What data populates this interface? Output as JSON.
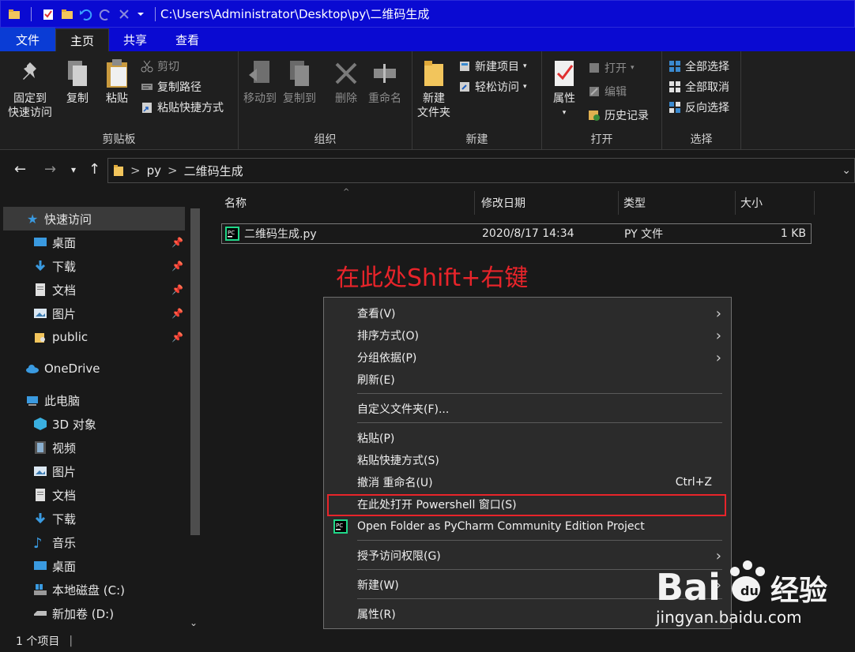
{
  "titlebar": {
    "path": "C:\\Users\\Administrator\\Desktop\\py\\二维码生成",
    "quick_access_icons": [
      "folder-icon",
      "properties-check-icon",
      "new-folder-icon",
      "undo-icon",
      "redo-icon",
      "delete-x-icon",
      "dropdown-arrow-icon"
    ]
  },
  "ribbon_tabs": {
    "file": "文件",
    "home": "主页",
    "share": "共享",
    "view": "查看"
  },
  "ribbon": {
    "clipboard": {
      "label": "剪贴板",
      "pin": "固定到\n快速访问",
      "pin_line1": "固定到",
      "pin_line2": "快速访问",
      "copy": "复制",
      "paste": "粘贴",
      "cut": "剪切",
      "copy_path": "复制路径",
      "paste_shortcut": "粘贴快捷方式"
    },
    "organize": {
      "label": "组织",
      "move_to": "移动到",
      "copy_to": "复制到",
      "delete": "删除",
      "rename": "重命名"
    },
    "new": {
      "label": "新建",
      "new_folder_line1": "新建",
      "new_folder_line2": "文件夹",
      "new_item": "新建项目",
      "easy_access": "轻松访问"
    },
    "open": {
      "label": "打开",
      "properties": "属性",
      "open": "打开",
      "edit": "编辑",
      "history": "历史记录"
    },
    "select": {
      "label": "选择",
      "select_all": "全部选择",
      "select_none": "全部取消",
      "invert": "反向选择"
    }
  },
  "address": {
    "crumbs": [
      "py",
      "二维码生成"
    ],
    "separator": ">"
  },
  "navpane": {
    "quick_access": "快速访问",
    "items": [
      {
        "label": "桌面",
        "pinned": true
      },
      {
        "label": "下载",
        "pinned": true
      },
      {
        "label": "文档",
        "pinned": true
      },
      {
        "label": "图片",
        "pinned": true
      },
      {
        "label": "public",
        "pinned": true
      }
    ],
    "onedrive": "OneDrive",
    "this_pc": "此电脑",
    "pc_items": [
      "3D 对象",
      "视频",
      "图片",
      "文档",
      "下载",
      "音乐",
      "桌面",
      "本地磁盘 (C:)",
      "新加卷 (D:)"
    ]
  },
  "filelist": {
    "columns": [
      "名称",
      "修改日期",
      "类型",
      "大小"
    ],
    "files": [
      {
        "name": "二维码生成.py",
        "modified": "2020/8/17 14:34",
        "type": "PY 文件",
        "size": "1 KB"
      }
    ]
  },
  "annotation": "在此处Shift+右键",
  "context_menu": {
    "items": [
      {
        "label": "查看(V)",
        "submenu": true
      },
      {
        "label": "排序方式(O)",
        "submenu": true
      },
      {
        "label": "分组依据(P)",
        "submenu": true
      },
      {
        "label": "刷新(E)",
        "submenu": false
      },
      {
        "label": "自定义文件夹(F)...",
        "submenu": false
      },
      {
        "label": "粘贴(P)",
        "submenu": false
      },
      {
        "label": "粘贴快捷方式(S)",
        "submenu": false
      },
      {
        "label": "撤消 重命名(U)",
        "submenu": false,
        "shortcut": "Ctrl+Z"
      },
      {
        "label": "在此处打开 Powershell 窗口(S)",
        "submenu": false
      },
      {
        "label": "Open Folder as PyCharm Community Edition Project",
        "submenu": false
      },
      {
        "label": "授予访问权限(G)",
        "submenu": true
      },
      {
        "label": "新建(W)",
        "submenu": true
      },
      {
        "label": "属性(R)",
        "submenu": false
      }
    ]
  },
  "statusbar": {
    "count": "1 个项目"
  },
  "watermark": {
    "brand": "Bai",
    "brand2": "经验",
    "url": "jingyan.baidu.com"
  },
  "colors": {
    "titlebar": "#0a0ad2",
    "annotation": "#e8242a",
    "background": "#191919"
  }
}
